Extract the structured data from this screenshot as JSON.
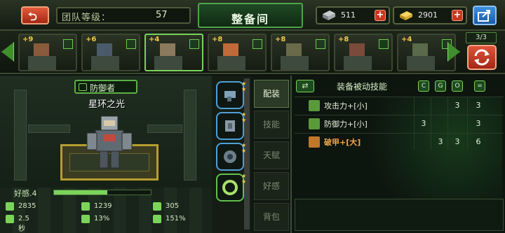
{
  "topbar": {
    "team_level_label": "团队等级：",
    "team_level_value": "57",
    "title": "整备间",
    "steel": "511",
    "gold": "2901"
  },
  "hero_strip": {
    "team_count": "3/3",
    "cards": [
      {
        "stars": "+9",
        "selected": false
      },
      {
        "stars": "+6",
        "selected": false
      },
      {
        "stars": "+4",
        "selected": true
      },
      {
        "stars": "+8",
        "selected": false
      },
      {
        "stars": "+8",
        "selected": false
      },
      {
        "stars": "+8",
        "selected": false
      },
      {
        "stars": "+4",
        "selected": false
      }
    ]
  },
  "hero": {
    "role": "防御者",
    "name": "星环之光",
    "affinity_label": "好感.4",
    "affinity_level": 0.55,
    "stats": [
      {
        "value": "2835",
        "icon": "heart-icon"
      },
      {
        "value": "1239",
        "icon": "attack-icon"
      },
      {
        "value": "305",
        "icon": "defense-icon"
      },
      {
        "value": "2.5秒",
        "icon": "speed-icon"
      },
      {
        "value": "13%",
        "icon": "crit-icon"
      },
      {
        "value": "151%",
        "icon": "crit-damage-icon"
      }
    ]
  },
  "tabs": [
    "配装",
    "技能",
    "天赋",
    "好感",
    "背包"
  ],
  "skills": {
    "title": "装备被动技能",
    "toggle": "⇄",
    "column_labels": [
      "C",
      "G",
      "O",
      "="
    ],
    "rows": [
      {
        "name": "攻击力+[小]",
        "cols": [
          "",
          "",
          "3",
          "3"
        ],
        "highlight": false
      },
      {
        "name": "防御力+[小]",
        "cols": [
          "3",
          "",
          "",
          "3"
        ],
        "highlight": false
      },
      {
        "name": "破甲+[大]",
        "cols": [
          "",
          "3",
          "3",
          "6"
        ],
        "highlight": true
      }
    ]
  }
}
